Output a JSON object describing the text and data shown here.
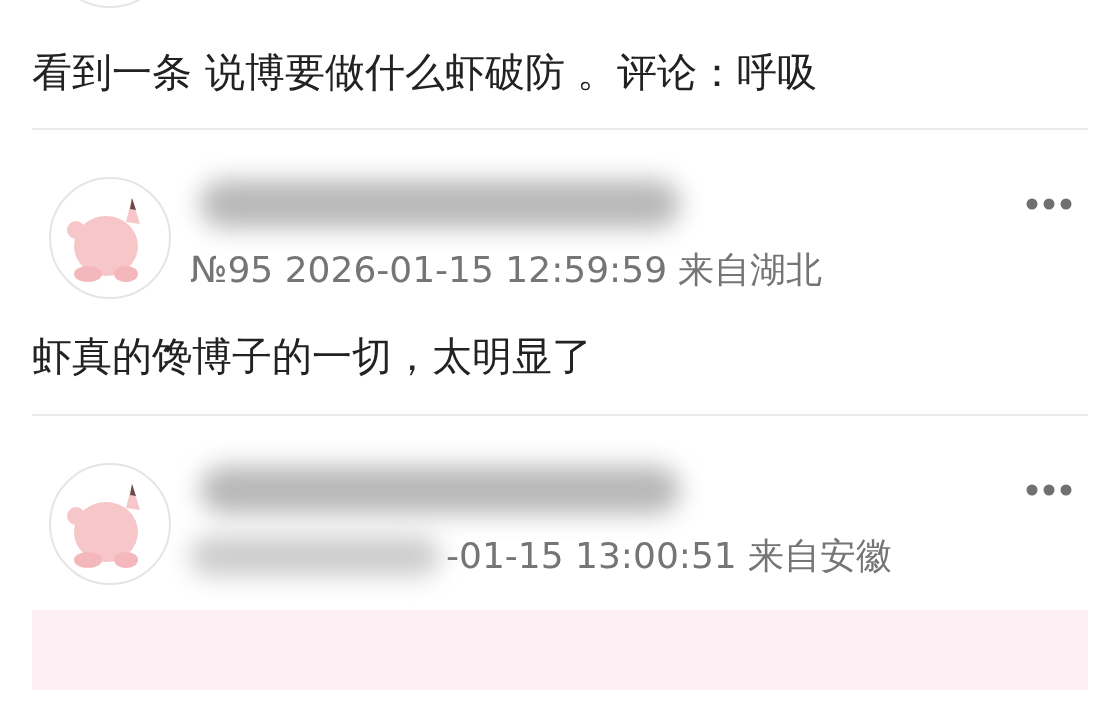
{
  "top_post": {
    "content": "看到一条 说博要做什么虾破防 。评论：呼吸"
  },
  "comments": [
    {
      "meta": "№95 2026-01-15 12:59:59 来自湖北",
      "meta_redacted": false,
      "content": "虾真的馋博子的一切，太明显了",
      "quoted": false
    },
    {
      "meta": "-01-15 13:00:51 来自安徽",
      "meta_redacted": true,
      "quoted": true
    }
  ]
}
